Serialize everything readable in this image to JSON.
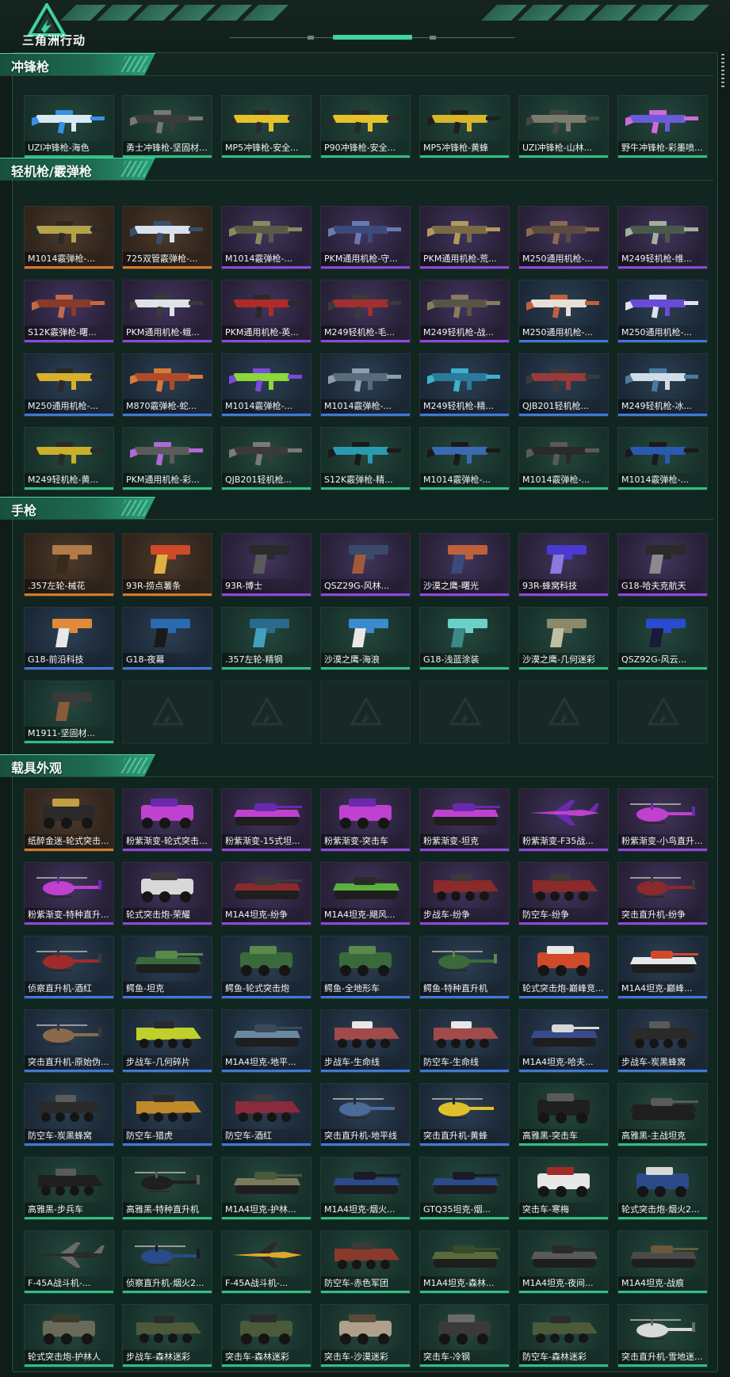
{
  "app": {
    "logo_text": "三角洲行动"
  },
  "colors": {
    "orange": "#d27b2b",
    "purple": "#8b4ad9",
    "blue": "#3f79d8",
    "green": "#2fbf82",
    "accent": "#3fd3a4"
  },
  "sections": [
    {
      "id": "smg",
      "title": "冲锋枪",
      "icon": "gun",
      "items": [
        {
          "label": "UZI冲锋枪-海色",
          "rarity": "green",
          "color": "#d8e8f5",
          "accent": "#3a8ee6"
        },
        {
          "label": "勇士冲锋枪-坚固材...",
          "rarity": "green",
          "color": "#3b3b3b",
          "accent": "#777777"
        },
        {
          "label": "MP5冲锋枪-安全...",
          "rarity": "green",
          "color": "#e6c22a",
          "accent": "#2b2b2b"
        },
        {
          "label": "P90冲锋枪-安全...",
          "rarity": "green",
          "color": "#e6c22a",
          "accent": "#2b2b2b"
        },
        {
          "label": "MP5冲锋枪-黄蜂",
          "rarity": "green",
          "color": "#d8b62a",
          "accent": "#1f1f1f"
        },
        {
          "label": "UZI冲锋枪-山林...",
          "rarity": "green",
          "color": "#7b7b6d",
          "accent": "#444444"
        },
        {
          "label": "野牛冲锋枪-彩墨喷...",
          "rarity": "green",
          "color": "#6a5bd8",
          "accent": "#cf6bd6"
        }
      ]
    },
    {
      "id": "lmg",
      "title": "轻机枪/霰弹枪",
      "icon": "gun",
      "items": [
        {
          "label": "M1014霰弹枪-...",
          "rarity": "orange",
          "color": "#b4a34a",
          "accent": "#2a2a2a"
        },
        {
          "label": "725双管霰弹枪-...",
          "rarity": "orange",
          "color": "#d8e2ee",
          "accent": "#3b4e6a"
        },
        {
          "label": "M1014霰弹枪-...",
          "rarity": "purple",
          "color": "#5a5a44",
          "accent": "#8a8a60"
        },
        {
          "label": "PKM通用机枪-守...",
          "rarity": "purple",
          "color": "#3a4a7a",
          "accent": "#6a7ab0"
        },
        {
          "label": "PKM通用机枪-荒...",
          "rarity": "purple",
          "color": "#7a6a44",
          "accent": "#b09a60"
        },
        {
          "label": "M250通用机枪-...",
          "rarity": "purple",
          "color": "#5a4a40",
          "accent": "#8a6a50"
        },
        {
          "label": "M249轻机枪-维...",
          "rarity": "purple",
          "color": "#4a5a4a",
          "accent": "#a0b0a0"
        },
        {
          "label": "S12K霰弹枪-曙...",
          "rarity": "purple",
          "color": "#8a3a2a",
          "accent": "#c06a4a"
        },
        {
          "label": "PKM通用机枪-蛾...",
          "rarity": "purple",
          "color": "#dfe3e8",
          "accent": "#3a3a3a"
        },
        {
          "label": "PKM通用机枪-英...",
          "rarity": "purple",
          "color": "#b02a2a",
          "accent": "#2a2a2a"
        },
        {
          "label": "M249轻机枪-毛...",
          "rarity": "purple",
          "color": "#a03030",
          "accent": "#3a3a3a"
        },
        {
          "label": "M249轻机枪-战...",
          "rarity": "purple",
          "color": "#5a5448",
          "accent": "#8a7a60"
        },
        {
          "label": "M250通用机枪-...",
          "rarity": "blue",
          "color": "#e8e0d4",
          "accent": "#c06040"
        },
        {
          "label": "M250通用机枪-...",
          "rarity": "blue",
          "color": "#6a4ad8",
          "accent": "#e0e0f0"
        },
        {
          "label": "M250通用机枪-...",
          "rarity": "blue",
          "color": "#d8b02a",
          "accent": "#2a2a2a"
        },
        {
          "label": "M870霰弹枪-蛇...",
          "rarity": "blue",
          "color": "#b04a2a",
          "accent": "#d87a3a"
        },
        {
          "label": "M1014霰弹枪-...",
          "rarity": "blue",
          "color": "#8ad83a",
          "accent": "#7a4ad8"
        },
        {
          "label": "M1014霰弹枪-...",
          "rarity": "blue",
          "color": "#5a6a7a",
          "accent": "#8aa0b0"
        },
        {
          "label": "M249轻机枪-精...",
          "rarity": "blue",
          "color": "#2a7a9a",
          "accent": "#40b0d0"
        },
        {
          "label": "QJB201轻机枪...",
          "rarity": "blue",
          "color": "#9a3a3a",
          "accent": "#3a3a3a"
        },
        {
          "label": "M249轻机枪-冰...",
          "rarity": "blue",
          "color": "#cfdde8",
          "accent": "#4a7aa0"
        },
        {
          "label": "M249轻机枪-黄...",
          "rarity": "green",
          "color": "#c8b02a",
          "accent": "#2a2a2a"
        },
        {
          "label": "PKM通用机枪-彩...",
          "rarity": "green",
          "color": "#5a5a5a",
          "accent": "#b06ad8"
        },
        {
          "label": "QJB201轻机枪...",
          "rarity": "green",
          "color": "#3a3a3a",
          "accent": "#7a7a7a"
        },
        {
          "label": "S12K霰弹枪-精...",
          "rarity": "green",
          "color": "#2a9ab0",
          "accent": "#1a1a1a"
        },
        {
          "label": "M1014霰弹枪-...",
          "rarity": "green",
          "color": "#3a6ab0",
          "accent": "#1a1a1a"
        },
        {
          "label": "M1014霰弹枪-...",
          "rarity": "green",
          "color": "#2a2a2a",
          "accent": "#5a5a5a"
        },
        {
          "label": "M1014霰弹枪-...",
          "rarity": "green",
          "color": "#2a5ab0",
          "accent": "#1a1a1a"
        }
      ]
    },
    {
      "id": "pistol",
      "title": "手枪",
      "icon": "pistol",
      "items": [
        {
          "label": ".357左轮-械花",
          "rarity": "orange",
          "color": "#b07a4a",
          "accent": "#3a2a1a"
        },
        {
          "label": "93R-捞点薯条",
          "rarity": "orange",
          "color": "#d04a2a",
          "accent": "#e0b040"
        },
        {
          "label": "93R-博士",
          "rarity": "purple",
          "color": "#2a2a2a",
          "accent": "#5a5a5a"
        },
        {
          "label": "QSZ29G-风林...",
          "rarity": "purple",
          "color": "#3a4a6a",
          "accent": "#a05a3a"
        },
        {
          "label": "沙漠之鹰-曙光",
          "rarity": "purple",
          "color": "#c0603a",
          "accent": "#3a4a7a"
        },
        {
          "label": "93R-蜂窝科技",
          "rarity": "purple",
          "color": "#4a3ad0",
          "accent": "#8a7ae0"
        },
        {
          "label": "G18-哈夫克航天",
          "rarity": "purple",
          "color": "#2a2a2a",
          "accent": "#8a8a8a"
        },
        {
          "label": "G18-前沿科技",
          "rarity": "blue",
          "color": "#e08a3a",
          "accent": "#e8e8e8"
        },
        {
          "label": "G18-夜幕",
          "rarity": "blue",
          "color": "#2a6ab0",
          "accent": "#1a1a1a"
        },
        {
          "label": ".357左轮-精钢",
          "rarity": "green",
          "color": "#2a6a8a",
          "accent": "#40a0c0"
        },
        {
          "label": "沙漠之鹰-海浪",
          "rarity": "green",
          "color": "#3a8ad0",
          "accent": "#e8e8e8"
        },
        {
          "label": "G18-浅蓝涂装",
          "rarity": "green",
          "color": "#6ad0c8",
          "accent": "#3a8a88"
        },
        {
          "label": "沙漠之鹰-几何迷彩",
          "rarity": "green",
          "color": "#8a8a6a",
          "accent": "#c0c0a0"
        },
        {
          "label": "QSZ92G-风云...",
          "rarity": "green",
          "color": "#2a4ad0",
          "accent": "#1a1a3a"
        },
        {
          "label": "M1911-坚固材...",
          "rarity": "green",
          "color": "#3a3a3a",
          "accent": "#8a5a3a"
        },
        {
          "label": "",
          "rarity": "empty"
        },
        {
          "label": "",
          "rarity": "empty"
        },
        {
          "label": "",
          "rarity": "empty"
        },
        {
          "label": "",
          "rarity": "empty"
        },
        {
          "label": "",
          "rarity": "empty"
        },
        {
          "label": "",
          "rarity": "empty"
        }
      ]
    },
    {
      "id": "vehicle",
      "title": "载具外观",
      "icon": "vehicle",
      "items": [
        {
          "label": "纸醉金迷-轮式突击...",
          "rarity": "orange",
          "color": "#2a2a2a",
          "accent": "#c0a040",
          "kind": "car"
        },
        {
          "label": "粉紫渐变-轮式突击...",
          "rarity": "purple",
          "color": "#c040d0",
          "accent": "#6a2ab0",
          "kind": "car"
        },
        {
          "label": "粉紫渐变-15式坦...",
          "rarity": "purple",
          "color": "#c040d0",
          "accent": "#6a2ab0",
          "kind": "tank"
        },
        {
          "label": "粉紫渐变-突击车",
          "rarity": "purple",
          "color": "#c040d0",
          "accent": "#6a2ab0",
          "kind": "car"
        },
        {
          "label": "粉紫渐变-坦克",
          "rarity": "purple",
          "color": "#c040d0",
          "accent": "#6a2ab0",
          "kind": "tank"
        },
        {
          "label": "粉紫渐变-F35战...",
          "rarity": "purple",
          "color": "#c040d0",
          "accent": "#6a2ab0",
          "kind": "jet"
        },
        {
          "label": "粉紫渐变-小鸟直升...",
          "rarity": "purple",
          "color": "#c040d0",
          "accent": "#6a2ab0",
          "kind": "heli"
        },
        {
          "label": "粉紫渐变-特种直升...",
          "rarity": "purple",
          "color": "#c040d0",
          "accent": "#6a2ab0",
          "kind": "heli"
        },
        {
          "label": "轮式突击炮-荣耀",
          "rarity": "purple",
          "color": "#d8d8d8",
          "accent": "#3a3a3a",
          "kind": "car"
        },
        {
          "label": "M1A4坦克-纷争",
          "rarity": "purple",
          "color": "#8a2a2a",
          "accent": "#3a3a3a",
          "kind": "tank"
        },
        {
          "label": "M1A4坦克-飓风...",
          "rarity": "purple",
          "color": "#5ab03a",
          "accent": "#2a2a2a",
          "kind": "tank"
        },
        {
          "label": "步战车-纷争",
          "rarity": "purple",
          "color": "#8a2a2a",
          "accent": "#3a3a3a",
          "kind": "apc"
        },
        {
          "label": "防空车-纷争",
          "rarity": "purple",
          "color": "#8a2a2a",
          "accent": "#3a3a3a",
          "kind": "apc"
        },
        {
          "label": "突击直升机-纷争",
          "rarity": "purple",
          "color": "#8a2a2a",
          "accent": "#3a3a3a",
          "kind": "heli"
        },
        {
          "label": "侦察直升机-酒红",
          "rarity": "blue",
          "color": "#a02a2a",
          "accent": "#3a3a3a",
          "kind": "heli"
        },
        {
          "label": "鳄鱼-坦克",
          "rarity": "blue",
          "color": "#3a6a3a",
          "accent": "#5a8a4a",
          "kind": "tank"
        },
        {
          "label": "鳄鱼-轮式突击炮",
          "rarity": "blue",
          "color": "#3a6a3a",
          "accent": "#5a8a4a",
          "kind": "car"
        },
        {
          "label": "鳄鱼-全地形车",
          "rarity": "blue",
          "color": "#3a6a3a",
          "accent": "#5a8a4a",
          "kind": "car"
        },
        {
          "label": "鳄鱼-特种直升机",
          "rarity": "blue",
          "color": "#3a6a3a",
          "accent": "#5a8a4a",
          "kind": "heli"
        },
        {
          "label": "轮式突击炮-巅峰竞...",
          "rarity": "blue",
          "color": "#d04a2a",
          "accent": "#e8e8e8",
          "kind": "car"
        },
        {
          "label": "M1A4坦克-巅峰...",
          "rarity": "blue",
          "color": "#e8e8e8",
          "accent": "#d04a2a",
          "kind": "tank"
        },
        {
          "label": "突击直升机-原始伪...",
          "rarity": "blue",
          "color": "#8a6a4a",
          "accent": "#3a3a3a",
          "kind": "heli"
        },
        {
          "label": "步战车-几何碎片",
          "rarity": "blue",
          "color": "#c0d02a",
          "accent": "#2a2a2a",
          "kind": "apc"
        },
        {
          "label": "M1A4坦克-地平...",
          "rarity": "blue",
          "color": "#6a8aa0",
          "accent": "#3a4a5a",
          "kind": "tank"
        },
        {
          "label": "步战车-生命线",
          "rarity": "blue",
          "color": "#a04a4a",
          "accent": "#e8e8e8",
          "kind": "apc"
        },
        {
          "label": "防空车-生命线",
          "rarity": "blue",
          "color": "#a04a4a",
          "accent": "#e8e8e8",
          "kind": "apc"
        },
        {
          "label": "M1A4坦克-哈夫...",
          "rarity": "blue",
          "color": "#3a4a8a",
          "accent": "#d8d8d8",
          "kind": "tank"
        },
        {
          "label": "步战车-炭黑蜂窝",
          "rarity": "blue",
          "color": "#2a2a2a",
          "accent": "#5a5a5a",
          "kind": "apc"
        },
        {
          "label": "防空车-炭黑蜂窝",
          "rarity": "blue",
          "color": "#2a2a2a",
          "accent": "#5a5a5a",
          "kind": "apc"
        },
        {
          "label": "防空车-猎虎",
          "rarity": "blue",
          "color": "#c08a2a",
          "accent": "#2a2a2a",
          "kind": "apc"
        },
        {
          "label": "防空车-酒红",
          "rarity": "blue",
          "color": "#8a2a3a",
          "accent": "#3a3a3a",
          "kind": "apc"
        },
        {
          "label": "突击直升机-地平线",
          "rarity": "blue",
          "color": "#4a6a9a",
          "accent": "#2a2a3a",
          "kind": "heli"
        },
        {
          "label": "突击直升机-黄蜂",
          "rarity": "blue",
          "color": "#e0c02a",
          "accent": "#2a2a2a",
          "kind": "heli"
        },
        {
          "label": "高雅黑-突击车",
          "rarity": "green",
          "color": "#1f1f1f",
          "accent": "#5a5a5a",
          "kind": "car"
        },
        {
          "label": "高雅黑-主战坦克",
          "rarity": "green",
          "color": "#1f1f1f",
          "accent": "#5a5a5a",
          "kind": "tank"
        },
        {
          "label": "高雅黑-步兵车",
          "rarity": "green",
          "color": "#1f1f1f",
          "accent": "#5a5a5a",
          "kind": "apc"
        },
        {
          "label": "高雅黑-特种直升机",
          "rarity": "green",
          "color": "#1f1f1f",
          "accent": "#5a5a5a",
          "kind": "heli"
        },
        {
          "label": "M1A4坦克-护林...",
          "rarity": "green",
          "color": "#7a7a5a",
          "accent": "#4a5a3a",
          "kind": "tank"
        },
        {
          "label": "M1A4坦克-烟火...",
          "rarity": "green",
          "color": "#2a4a8a",
          "accent": "#1a1a2a",
          "kind": "tank"
        },
        {
          "label": "GTQ35坦克-烟...",
          "rarity": "green",
          "color": "#2a4a8a",
          "accent": "#1a1a2a",
          "kind": "tank"
        },
        {
          "label": "突击车-寒梅",
          "rarity": "green",
          "color": "#e8e8e8",
          "accent": "#a02a2a",
          "kind": "car"
        },
        {
          "label": "轮式突击炮-烟火2...",
          "rarity": "green",
          "color": "#2a4a8a",
          "accent": "#d8d8d8",
          "kind": "car"
        },
        {
          "label": "F-45A战斗机-...",
          "rarity": "green",
          "color": "#2a2a2a",
          "accent": "#6a6a6a",
          "kind": "jet"
        },
        {
          "label": "侦察直升机-烟火2...",
          "rarity": "green",
          "color": "#2a4a8a",
          "accent": "#1a1a2a",
          "kind": "heli"
        },
        {
          "label": "F-45A战斗机-...",
          "rarity": "green",
          "color": "#e0a82a",
          "accent": "#2a2a2a",
          "kind": "jet"
        },
        {
          "label": "防空车-赤色军团",
          "rarity": "green",
          "color": "#8a3a2a",
          "accent": "#3a3a3a",
          "kind": "apc"
        },
        {
          "label": "M1A4坦克-森林...",
          "rarity": "green",
          "color": "#5a6a3a",
          "accent": "#3a4a2a",
          "kind": "tank"
        },
        {
          "label": "M1A4坦克-夜间...",
          "rarity": "green",
          "color": "#5a5a5a",
          "accent": "#2a2a2a",
          "kind": "tank"
        },
        {
          "label": "M1A4坦克-战痕",
          "rarity": "green",
          "color": "#4a4a4a",
          "accent": "#6a5a3a",
          "kind": "tank"
        },
        {
          "label": "轮式突击炮-护林人",
          "rarity": "green",
          "color": "#6a6a5a",
          "accent": "#3a3a2a",
          "kind": "car"
        },
        {
          "label": "步战车-森林迷彩",
          "rarity": "green",
          "color": "#4a5a3a",
          "accent": "#2a2a2a",
          "kind": "apc"
        },
        {
          "label": "突击车-森林迷彩",
          "rarity": "green",
          "color": "#4a5a3a",
          "accent": "#2a2a2a",
          "kind": "car"
        },
        {
          "label": "突击车-沙漠迷彩",
          "rarity": "green",
          "color": "#b0a08a",
          "accent": "#5a4a3a",
          "kind": "car"
        },
        {
          "label": "突击车-冷钢",
          "rarity": "green",
          "color": "#3a3a3a",
          "accent": "#6a6a6a",
          "kind": "car"
        },
        {
          "label": "防空车-森林迷彩",
          "rarity": "green",
          "color": "#4a5a3a",
          "accent": "#2a2a2a",
          "kind": "apc"
        },
        {
          "label": "突击直升机-雪地迷...",
          "rarity": "green",
          "color": "#d8d8d8",
          "accent": "#6a6a6a",
          "kind": "heli"
        }
      ]
    }
  ]
}
